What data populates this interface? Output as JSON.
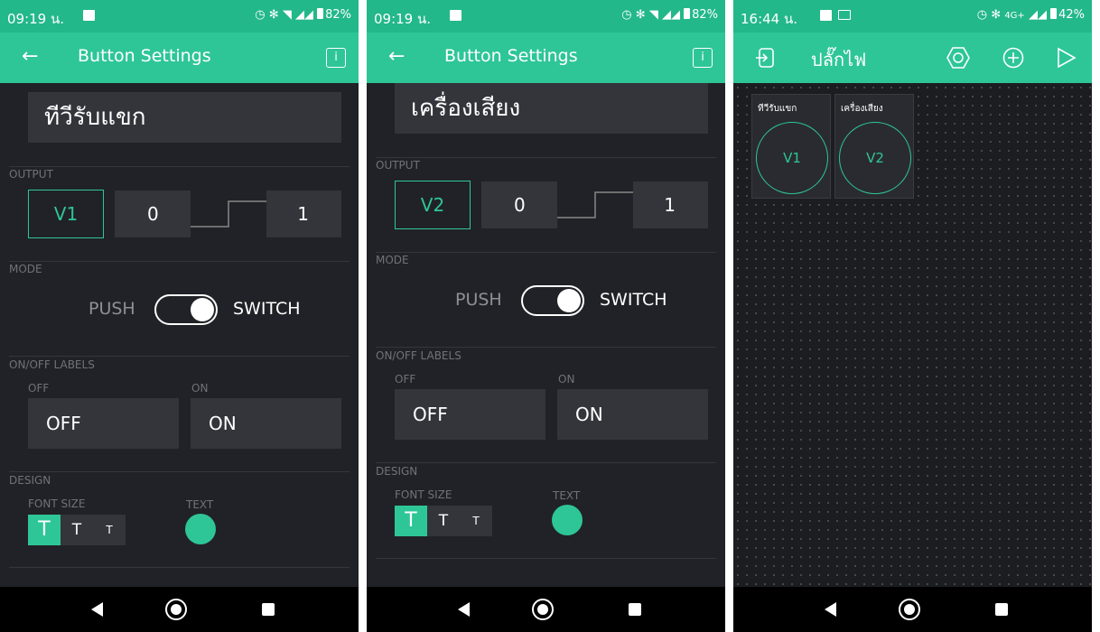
{
  "accent_color": "#2ec696",
  "screens": [
    {
      "status_bar": {
        "time": "09:19 น.",
        "battery": "82%"
      },
      "app_bar": {
        "title": "Button Settings",
        "info_label": "i"
      },
      "name": "ทีวีรับแขก",
      "output": {
        "section_label": "OUTPUT",
        "pin": "V1",
        "low": "0",
        "high": "1"
      },
      "mode": {
        "section_label": "MODE",
        "push_label": "PUSH",
        "switch_label": "SWITCH",
        "selected": "SWITCH"
      },
      "labels": {
        "section_label": "ON/OFF LABELS",
        "off_caption": "OFF",
        "on_caption": "ON",
        "off_value": "OFF",
        "on_value": "ON"
      },
      "design": {
        "section_label": "DESIGN",
        "font_size_label": "FONT SIZE",
        "text_label": "TEXT",
        "sizes": [
          "T",
          "T",
          "T"
        ],
        "selected_size": 0,
        "text_color": "#2ec696"
      }
    },
    {
      "status_bar": {
        "time": "09:19 น.",
        "battery": "82%"
      },
      "app_bar": {
        "title": "Button Settings",
        "info_label": "i"
      },
      "name": "เครื่องเสียง",
      "output": {
        "section_label": "OUTPUT",
        "pin": "V2",
        "low": "0",
        "high": "1"
      },
      "mode": {
        "section_label": "MODE",
        "push_label": "PUSH",
        "switch_label": "SWITCH",
        "selected": "SWITCH"
      },
      "labels": {
        "section_label": "ON/OFF LABELS",
        "off_caption": "OFF",
        "on_caption": "ON",
        "off_value": "OFF",
        "on_value": "ON"
      },
      "design": {
        "section_label": "DESIGN",
        "font_size_label": "FONT SIZE",
        "text_label": "TEXT",
        "sizes": [
          "T",
          "T",
          "T"
        ],
        "selected_size": 0,
        "text_color": "#2ec696"
      }
    },
    {
      "status_bar": {
        "time": "16:44 น.",
        "network": "4G+",
        "battery": "42%"
      },
      "app_bar": {
        "title": "ปลั๊กไฟ"
      },
      "widgets": [
        {
          "label": "ทีวีรับแขก",
          "pin": "V1"
        },
        {
          "label": "เครื่องเสียง",
          "pin": "V2"
        }
      ]
    }
  ]
}
